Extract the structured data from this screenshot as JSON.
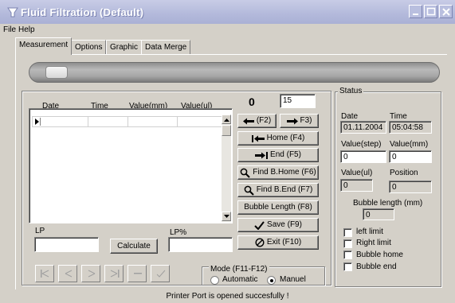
{
  "window": {
    "title": "Fluid Filtration  (Default)"
  },
  "menu": {
    "file": "File",
    "help": "Help"
  },
  "tabs": [
    "Measurement",
    "Options",
    "Graphic",
    "Data Merge"
  ],
  "progress": {
    "value_fraction": 0.02
  },
  "grid": {
    "columns": [
      "Date",
      "Time",
      "Value(mm)",
      "Value(ul)"
    ]
  },
  "counter": {
    "value": "0",
    "step": "15"
  },
  "buttons": {
    "left": "(F2)",
    "right": "F3)",
    "home": "Home (F4)",
    "end": "End (F5)",
    "find_bhome": "Find B.Home (F6)",
    "find_bend": "Find B.End (F7)",
    "bubble_length": "Bubble Length (F8)",
    "save": "Save (F9)",
    "exit": "Exit (F10)",
    "calculate": "Calculate"
  },
  "lp": {
    "label": "LP",
    "value": ""
  },
  "lp_percent": {
    "label": "LP%",
    "value": ""
  },
  "mode": {
    "title": "Mode (F11-F12)",
    "automatic": "Automatic",
    "manual": "Manuel",
    "selected": "Manuel"
  },
  "status": {
    "title": "Status",
    "date_label": "Date",
    "date_value": "01.11.2004",
    "time_label": "Time",
    "time_value": "05:04:58",
    "value_step_label": "Value(step)",
    "value_step": "0",
    "value_mm_label": "Value(mm)",
    "value_mm": "0",
    "value_ul_label": "Value(ul)",
    "value_ul": "0",
    "position_label": "Position",
    "position": "0",
    "bubble_length_label": "Bubble length (mm)",
    "bubble_length": "0",
    "checks": [
      {
        "label": "left limit",
        "checked": false
      },
      {
        "label": "Right limit",
        "checked": false
      },
      {
        "label": "Bubble home",
        "checked": false
      },
      {
        "label": "Bubble end",
        "checked": false
      }
    ]
  },
  "status_bar": "Printer Port is opened succesfully !",
  "colors": {
    "titlebar": "#b3b9db",
    "face": "#d4d0c8",
    "desktop": "#aeb7d8"
  },
  "icons": [
    "app-icon",
    "minimize-icon",
    "maximize-icon",
    "close-icon",
    "arrow-left-icon",
    "arrow-right-icon",
    "home-icon",
    "end-icon",
    "magnifier-icon",
    "checkmark-icon",
    "no-entry-icon"
  ]
}
